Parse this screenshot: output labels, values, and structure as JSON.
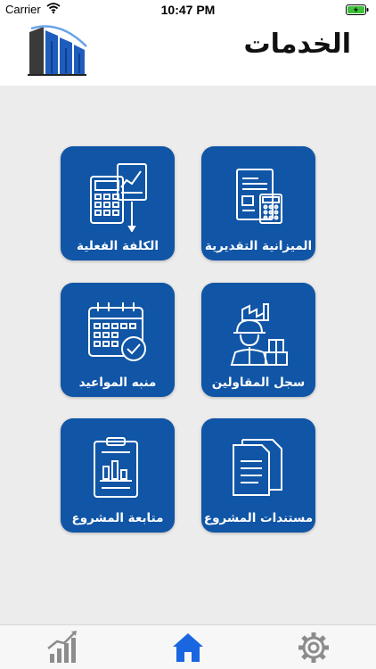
{
  "status_bar": {
    "carrier": "Carrier",
    "time": "10:47 PM"
  },
  "header": {
    "title": "الخدمات"
  },
  "services": [
    {
      "label": "الميزانية التقديرية",
      "icon": "budget-calculator-icon"
    },
    {
      "label": "الكلفة الفعلية",
      "icon": "actual-cost-calculator-icon"
    },
    {
      "label": "سجل المقاولين",
      "icon": "contractor-worker-icon"
    },
    {
      "label": "منبه المواعيد",
      "icon": "calendar-check-icon"
    },
    {
      "label": "مستندات المشروع",
      "icon": "documents-icon"
    },
    {
      "label": "متابعة المشروع",
      "icon": "clipboard-chart-icon"
    }
  ],
  "tabs": [
    {
      "icon": "stats-chart-icon",
      "active": false
    },
    {
      "icon": "home-icon",
      "active": true
    },
    {
      "icon": "settings-gear-icon",
      "active": false
    }
  ],
  "colors": {
    "tile_blue": "#1055a6",
    "content_bg": "#ececec",
    "tab_active": "#1a66e0",
    "tab_inactive": "#8c8c8c",
    "battery_green": "#3cc13b"
  }
}
